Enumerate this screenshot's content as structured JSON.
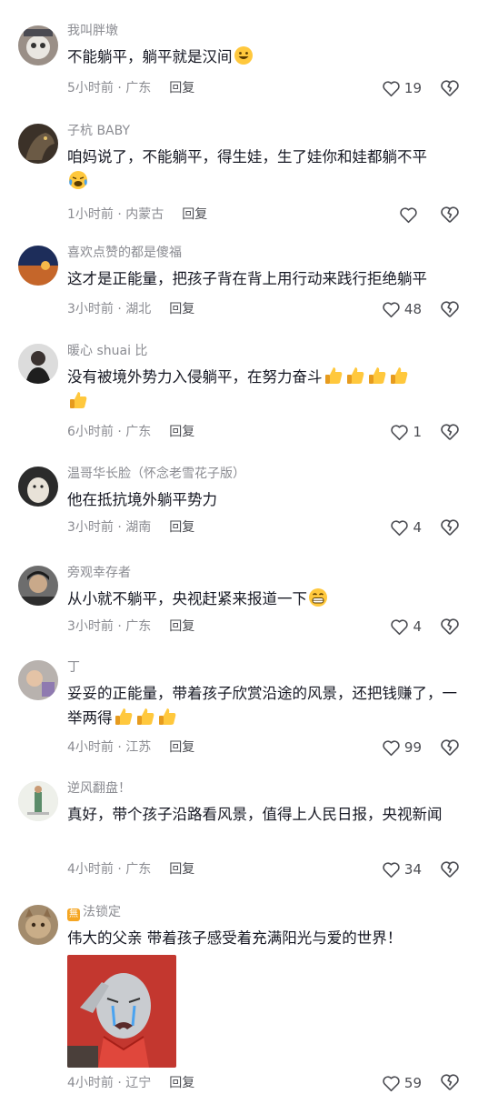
{
  "comments": [
    {
      "user": "我叫胖墩",
      "text": "不能躺平，躺平就是汉间",
      "time": "5小时前 · 广东",
      "reply": "回复",
      "likes": "19"
    },
    {
      "user": "子杭 BABY",
      "text": "咱妈说了，不能躺平，得生娃，生了娃你和娃都躺不平",
      "time": "1小时前 · 内蒙古",
      "reply": "回复",
      "likes": ""
    },
    {
      "user": "喜欢点赞的都是傻福",
      "text": "这才是正能量，把孩子背在背上用行动来践行拒绝躺平",
      "time": "3小时前 · 湖北",
      "reply": "回复",
      "likes": "48"
    },
    {
      "user": "暖心 shuai 比",
      "text": "没有被境外势力入侵躺平，在努力奋斗",
      "time": "6小时前 · 广东",
      "reply": "回复",
      "likes": "1"
    },
    {
      "user": "温哥华长脸（怀念老雪花子版）",
      "text": "他在抵抗境外躺平势力",
      "time": "3小时前 · 湖南",
      "reply": "回复",
      "likes": "4"
    },
    {
      "user": "旁观幸存者",
      "text": "从小就不躺平，央视赶紧来报道一下",
      "time": "3小时前 · 广东",
      "reply": "回复",
      "likes": "4"
    },
    {
      "user": "丁",
      "text": "妥妥的正能量，带着孩子欣赏沿途的风景，还把钱赚了，一举两得",
      "time": "4小时前 · 江苏",
      "reply": "回复",
      "likes": "99"
    },
    {
      "user": "逆风翻盘！",
      "text": "真好，带个孩子沿路看风景，值得上人民日报，央视新闻",
      "time": "4小时前 · 广东",
      "reply": "回复",
      "likes": "34"
    },
    {
      "user": "法锁定",
      "user_tag": "無",
      "text": "伟大的父亲 带着孩子感受着充满阳光与爱的世界！",
      "time": "4小时前 · 辽宁",
      "reply": "回复",
      "likes": "59"
    }
  ],
  "icons": {
    "like": "heart-outline-icon",
    "dislike": "broken-heart-icon"
  },
  "colors": {
    "secondary": "#8a8b91",
    "text": "#161823",
    "emoji": "#ffc83d",
    "meme_bg": "#c3372f"
  }
}
